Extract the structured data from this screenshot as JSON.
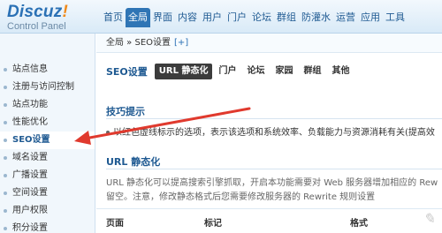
{
  "logo": {
    "brand": "Discuz",
    "bang": "!",
    "subtitle": "Control Panel"
  },
  "topnav": [
    "首页",
    "全局",
    "界面",
    "内容",
    "用户",
    "门户",
    "论坛",
    "群组",
    "防灌水",
    "运营",
    "应用",
    "工具"
  ],
  "topnav_active": 1,
  "sidebar": [
    "站点信息",
    "注册与访问控制",
    "站点功能",
    "性能优化",
    "SEO设置",
    "域名设置",
    "广播设置",
    "空间设置",
    "用户权限",
    "积分设置"
  ],
  "sidebar_active": 4,
  "breadcrumb": {
    "text": "全局 » SEO设置",
    "add": "[+]"
  },
  "tabs": {
    "title": "SEO设置",
    "items": [
      "URL 静态化",
      "门户",
      "论坛",
      "家园",
      "群组",
      "其他"
    ],
    "active": 0
  },
  "tips": {
    "title": "技巧提示",
    "text": "以红色虚线标示的选项，表示该选项和系统效率、负载能力与资源消耗有关(提高效"
  },
  "url_section": {
    "title": "URL 静态化",
    "desc1": "URL 静态化可以提高搜索引擎抓取，开启本功能需要对 Web 服务器增加相应的 Rew",
    "desc2": "留空。注意，修改静态格式后您需要修改服务器的 Rewrite 规则设置"
  },
  "table_headers": [
    "页面",
    "标记",
    "格式"
  ],
  "colors": {
    "accent": "#2f75b5",
    "arrow": "#e03a2e",
    "logo_bang": "#f08a1a"
  }
}
